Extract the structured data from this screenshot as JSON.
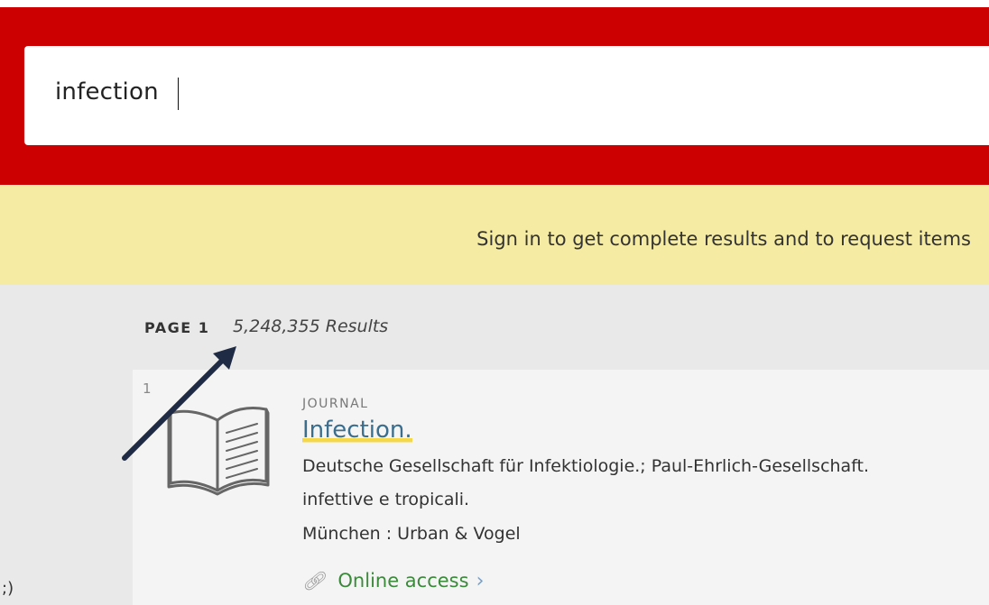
{
  "search": {
    "query": "infection"
  },
  "signin": {
    "message": "Sign in to get complete results and to request items"
  },
  "results": {
    "page_label": "PAGE 1",
    "count_text": "5,248,355 Results",
    "left_fragment": ";)",
    "items": [
      {
        "index": "1",
        "type": "JOURNAL",
        "title": "Infection.",
        "line1": "Deutsche Gesellschaft für Infektiologie.; Paul-Ehrlich-Gesellschaft.",
        "line2": "infettive e tropicali.",
        "line3": "München : Urban & Vogel",
        "online_access_label": "Online access",
        "icon": "book-icon"
      }
    ]
  },
  "colors": {
    "header_red": "#cc0000",
    "signin_yellow": "#f6eba3",
    "title_blue": "#3b6d8c",
    "online_green": "#3a8a3a",
    "arrow_navy": "#1f2a44"
  },
  "annotation": {
    "icon": "arrow-pointer-icon"
  }
}
